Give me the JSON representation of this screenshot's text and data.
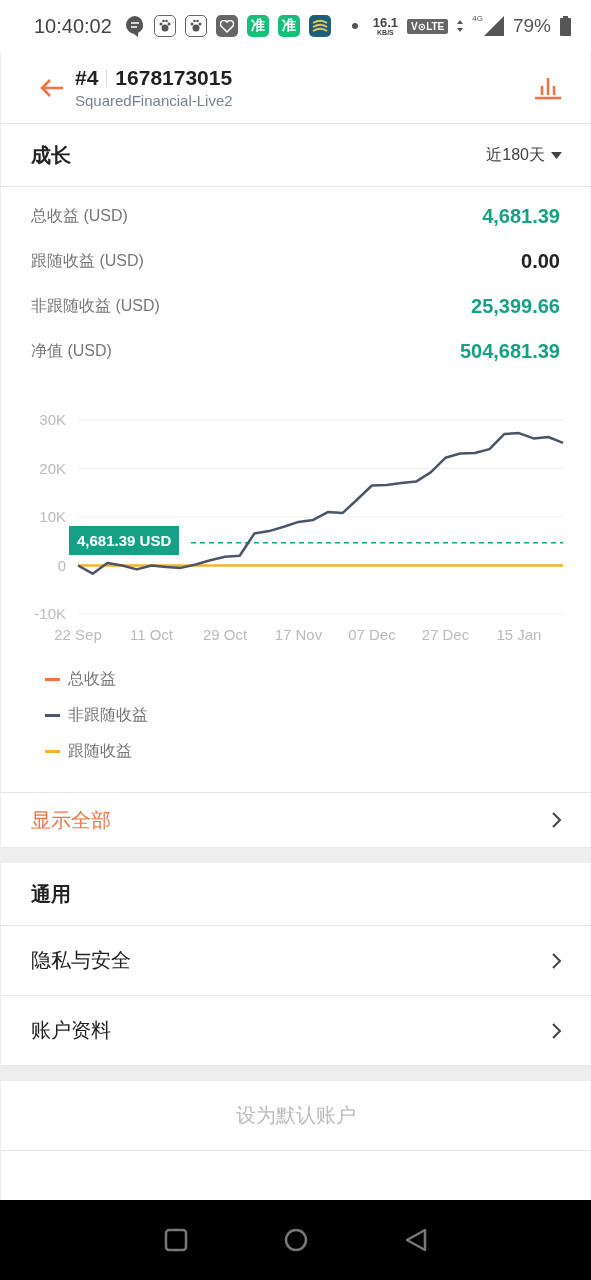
{
  "status_bar": {
    "time": "10:40:02",
    "app_badges": [
      "准",
      "准"
    ],
    "speed": "16.1",
    "speed_unit": "KB/S",
    "volte": "V⊙LTE",
    "network": "4G",
    "battery": "79%"
  },
  "header": {
    "number": "#4",
    "account": "1678173015",
    "server": "SquaredFinancial-Live2"
  },
  "growth": {
    "title": "成长",
    "period": "近180天",
    "stats": [
      {
        "label": "总收益 (USD)",
        "value": "4,681.39",
        "positive": true
      },
      {
        "label": "跟随收益 (USD)",
        "value": "0.00",
        "positive": false
      },
      {
        "label": "非跟随收益 (USD)",
        "value": "25,399.66",
        "positive": true
      },
      {
        "label": "净值 (USD)",
        "value": "504,681.39",
        "positive": true
      }
    ],
    "chart_data": {
      "type": "line",
      "categories": [
        "22 Sep",
        null,
        null,
        null,
        null,
        "11 Oct",
        null,
        null,
        null,
        null,
        "29 Oct",
        null,
        null,
        null,
        null,
        "17 Nov",
        null,
        null,
        null,
        null,
        "07 Dec",
        null,
        null,
        null,
        null,
        "27 Dec",
        null,
        null,
        null,
        null,
        "15 Jan",
        null,
        null,
        null
      ],
      "series": [
        {
          "name": "总收益",
          "color": "#f07245",
          "values": [
            null,
            null,
            null,
            null,
            null,
            null,
            null,
            null,
            null,
            null,
            null,
            null,
            null,
            null,
            null,
            null,
            null,
            null,
            null,
            null,
            null,
            null,
            null,
            null,
            null,
            null,
            null,
            null,
            null,
            null,
            null,
            null,
            null,
            null
          ]
        },
        {
          "name": "非跟随收益",
          "color": "#4a5568",
          "values": [
            0,
            -1700,
            500,
            0,
            -800,
            0,
            -300,
            -500,
            200,
            1100,
            1800,
            2000,
            6600,
            7100,
            8000,
            9000,
            9400,
            11000,
            10800,
            13600,
            16500,
            16600,
            17000,
            17300,
            19200,
            22200,
            23100,
            23200,
            24000,
            27100,
            27300,
            26200,
            26500,
            25300
          ]
        },
        {
          "name": "跟随收益",
          "color": "#f0b429",
          "values": [
            0,
            0,
            0,
            0,
            0,
            0,
            0,
            0,
            0,
            0,
            0,
            0,
            0,
            0,
            0,
            0,
            0,
            0,
            0,
            0,
            0,
            0,
            0,
            0,
            0,
            0,
            0,
            0,
            0,
            0,
            0,
            0,
            0,
            0
          ]
        }
      ],
      "ylim": [
        -10000,
        30000
      ],
      "yticks": [
        {
          "value": 30000,
          "label": "30K"
        },
        {
          "value": 20000,
          "label": "20K"
        },
        {
          "value": 10000,
          "label": "10K"
        },
        {
          "value": 0,
          "label": "0"
        },
        {
          "value": -10000,
          "label": "-10K"
        }
      ],
      "ref_lines": [
        {
          "axis": "y",
          "value": 4681.39,
          "label": "4,681.39 USD",
          "color": "#16a085"
        }
      ]
    },
    "show_all": "显示全部"
  },
  "general": {
    "title": "通用",
    "items": [
      "隐私与安全",
      "账户资料"
    ]
  },
  "default_button": "设为默认账户"
}
